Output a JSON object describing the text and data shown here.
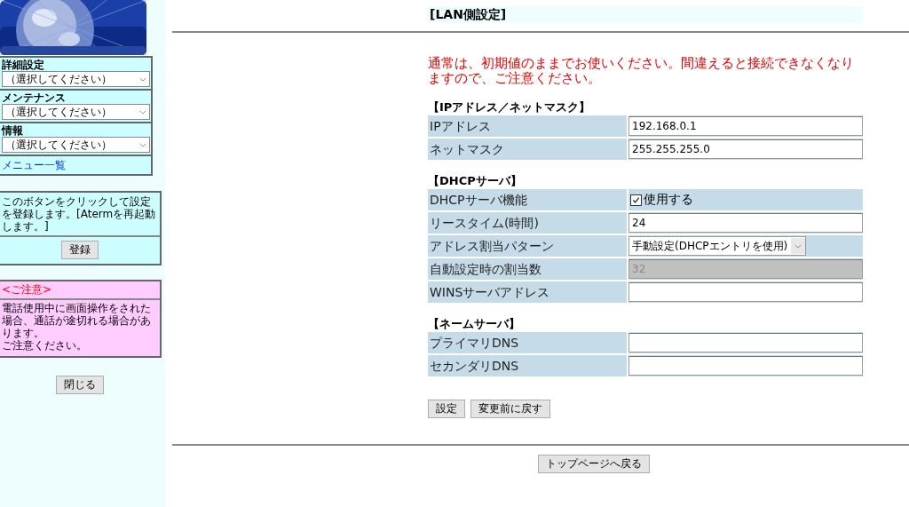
{
  "sidebar": {
    "menus": [
      {
        "label": "詳細設定",
        "value": "（選択してください）"
      },
      {
        "label": "メンテナンス",
        "value": "（選択してください）"
      },
      {
        "label": "情報",
        "value": "（選択してください）"
      }
    ],
    "menu_link": "メニュー一覧",
    "register": {
      "text": "このボタンをクリックして設定を登録します。[Atermを再起動します。]",
      "button": "登録"
    },
    "caution": {
      "title": "<ご注意>",
      "lines": [
        "電話使用中に画面操作をされた場合、通話が途切れる場合があります。",
        "ご注意ください。"
      ]
    },
    "close_button": "閉じる"
  },
  "main": {
    "heading": "[LAN側設定]",
    "warning": "通常は、初期値のままでお使いください。間違えると接続できなくなりますので、ご注意ください。",
    "sections": [
      {
        "title": "【IPアドレス／ネットマスク】",
        "rows": [
          {
            "label": "IPアドレス",
            "kind": "text",
            "value": "192.168.0.1",
            "disabled": false
          },
          {
            "label": "ネットマスク",
            "kind": "text",
            "value": "255.255.255.0",
            "disabled": false
          }
        ]
      },
      {
        "title": "【DHCPサーバ】",
        "rows": [
          {
            "label": "DHCPサーバ機能",
            "kind": "checkbox",
            "value": "使用する",
            "checked": true
          },
          {
            "label": "リースタイム(時間)",
            "kind": "text",
            "value": "24",
            "disabled": false
          },
          {
            "label": "アドレス割当パターン",
            "kind": "select",
            "value": "手動設定(DHCPエントリを使用)"
          },
          {
            "label": "自動設定時の割当数",
            "kind": "text",
            "value": "32",
            "disabled": true
          },
          {
            "label": "WINSサーバアドレス",
            "kind": "text",
            "disabled": false
          }
        ]
      },
      {
        "title": "【ネームサーバ】",
        "rows": [
          {
            "label": "プライマリDNS",
            "kind": "text",
            "disabled": false
          },
          {
            "label": "セカンダリDNS",
            "kind": "text",
            "disabled": false
          }
        ]
      }
    ],
    "buttons": [
      "設定",
      "変更前に戻す"
    ],
    "top_button": "トップページへ戻る"
  }
}
